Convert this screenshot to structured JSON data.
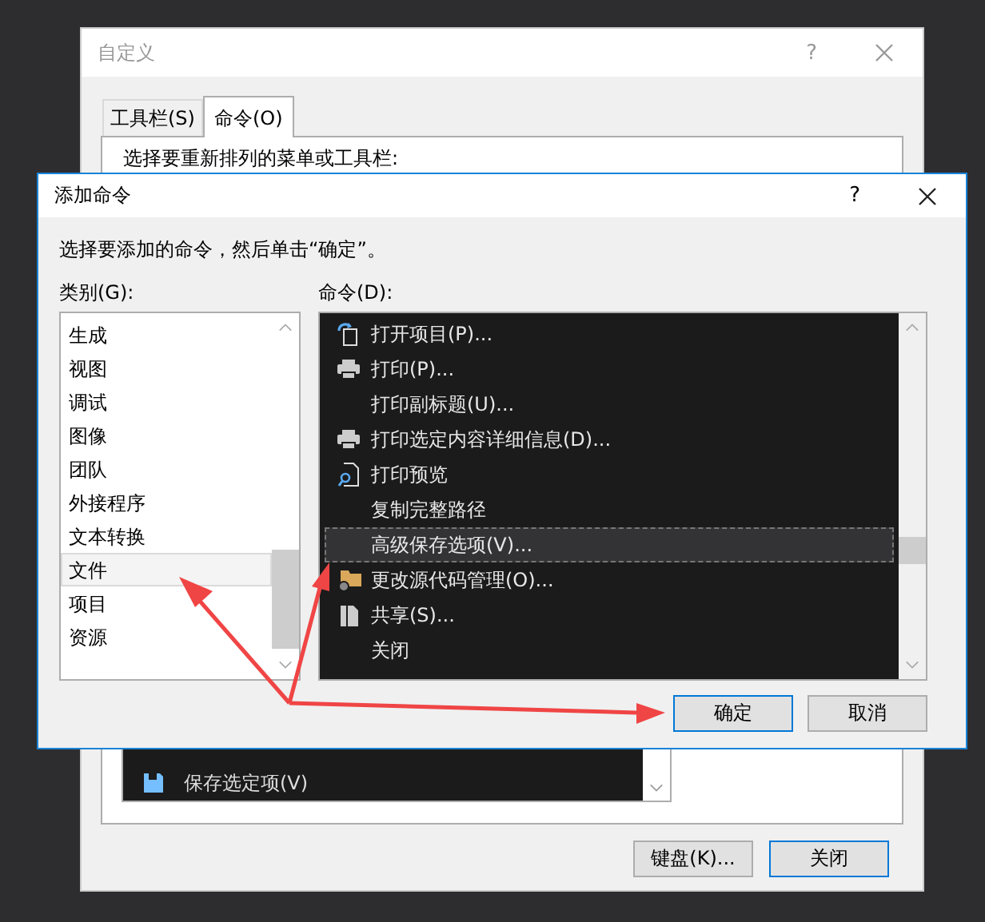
{
  "customize_window": {
    "title": "自定义",
    "help": "?",
    "tabs": [
      {
        "label": "工具栏(S)",
        "selected": false
      },
      {
        "label": "命令(O)",
        "selected": true
      }
    ],
    "prompt": "选择要重新排列的菜单或工具栏:",
    "commands": [
      {
        "label": "保存选定项(V)",
        "kind": "save"
      }
    ],
    "buttons": [
      {
        "label": "键盘(K)...",
        "default": false
      },
      {
        "label": "关闭",
        "default": true
      }
    ]
  },
  "add_command_dialog": {
    "title": "添加命令",
    "help": "?",
    "instruction": "选择要添加的命令，然后单击“确定”。",
    "categories_label": "类别(G):",
    "commands_label": "命令(D):",
    "categories": [
      {
        "label": "生成",
        "selected": false
      },
      {
        "label": "视图",
        "selected": false
      },
      {
        "label": "调试",
        "selected": false
      },
      {
        "label": "图像",
        "selected": false
      },
      {
        "label": "团队",
        "selected": false
      },
      {
        "label": "外接程序",
        "selected": false
      },
      {
        "label": "文本转换",
        "selected": false
      },
      {
        "label": "文件",
        "selected": true
      },
      {
        "label": "项目",
        "selected": false
      },
      {
        "label": "资源",
        "selected": false
      }
    ],
    "commands": [
      {
        "label": "打开项目(P)...",
        "kind": "open",
        "selected": false
      },
      {
        "label": "打印(P)...",
        "kind": "printer",
        "selected": false
      },
      {
        "label": "打印副标题(U)...",
        "kind": "plain",
        "selected": false
      },
      {
        "label": "打印选定内容详细信息(D)...",
        "kind": "printer",
        "selected": false
      },
      {
        "label": "打印预览",
        "kind": "preview",
        "selected": false
      },
      {
        "label": "复制完整路径",
        "kind": "plain",
        "selected": false
      },
      {
        "label": "高级保存选项(V)...",
        "kind": "plain",
        "selected": true
      },
      {
        "label": "更改源代码管理(O)...",
        "kind": "folder",
        "selected": false
      },
      {
        "label": "共享(S)...",
        "kind": "share",
        "selected": false
      },
      {
        "label": "关闭",
        "kind": "plain",
        "selected": false
      }
    ],
    "buttons": [
      {
        "label": "确定",
        "default": true
      },
      {
        "label": "取消",
        "default": false
      }
    ]
  }
}
